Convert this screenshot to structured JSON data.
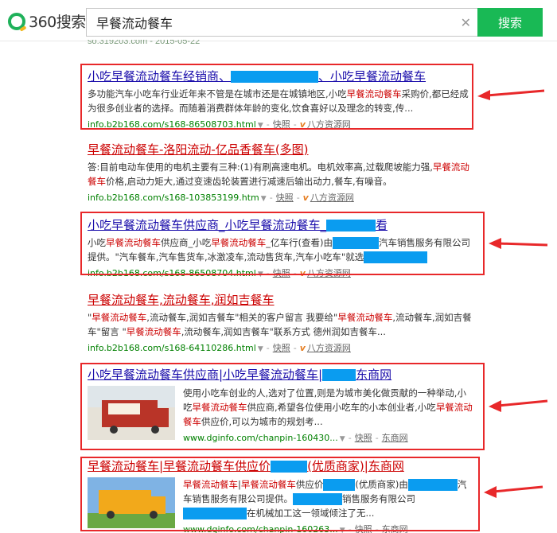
{
  "header": {
    "logo_text": "360搜索",
    "search_value": "早餐流动餐车",
    "search_button": "搜索"
  },
  "prev_result_url": "so.319203.com - 2015-05-22",
  "annotation_color": "#e8282a",
  "redaction_color": "#0a9cf0",
  "results": [
    {
      "title_a": "小吃早餐流动餐车经销商、",
      "title_b": "、小吃早餐流动餐车",
      "desc_1": "多功能汽车小吃车行业近年来不管是在城市还是在城镇地区,小吃",
      "desc_hl_1": "早餐流动餐车",
      "desc_2": "采购价,都已经成为很多创业者的选择。而随着消费群体年龄的变化,饮食喜好以及理念的转变,传...",
      "url": "info.b2b168.com/s168-86508703.html",
      "snapshot": "快照",
      "source": "八方资源网"
    },
    {
      "title": "早餐流动餐车-洛阳流动-亿品香餐车(多图)",
      "desc_1": "答:目前电动车使用的电机主要有三种:(1)有刷高速电机。电机效率高,过载爬坡能力强,",
      "desc_hl_1": "早餐流动餐车",
      "desc_2": "价格,启动力矩大,通过变速齿轮装置进行减速后输出动力,餐车,有噪音。",
      "url": "info.b2b168.com/s168-103853199.htm",
      "snapshot": "快照",
      "source": "八方资源网"
    },
    {
      "title_a": "小吃早餐流动餐车供应商_小吃早餐流动餐车_",
      "title_b": "看",
      "desc_1": "小吃",
      "desc_hl_1": "早餐流动餐车",
      "desc_2": "供应商_小吃",
      "desc_hl_2": "早餐流动餐车",
      "desc_3": "_亿车行(查看)由",
      "desc_4": "汽车销售服务有限公司提供。\"汽车餐车,汽车售货车,冰激凌车,流动售货车,汽车小吃车\"就选",
      "url": "info.b2b168.com/s168-86508704.html",
      "snapshot": "快照",
      "source": "八方资源网"
    },
    {
      "title": "早餐流动餐车,流动餐车,润如吉餐车",
      "desc_1": "\"",
      "desc_hl_1": "早餐流动餐车",
      "desc_2": ",流动餐车,润如吉餐车\"相关的客户留言 我要给\"",
      "desc_hl_2": "早餐流动餐车",
      "desc_3": ",流动餐车,润如吉餐车\"留言 \"",
      "desc_hl_3": "早餐流动餐车",
      "desc_4": ",流动餐车,润如吉餐车\"联系方式 德州润如吉餐车...",
      "url": "info.b2b168.com/s168-64110286.html",
      "snapshot": "快照",
      "source": "八方资源网"
    },
    {
      "title_a": "小吃早餐流动餐车供应商|小吃早餐流动餐车|",
      "title_b": "东商网",
      "desc_1": "使用小吃车创业的人,选对了位置,则是为城市美化做贡献的一种举动,小吃",
      "desc_hl_1": "早餐流动餐车",
      "desc_2": "供应商,希望各位使用小吃车的小本创业者,小吃",
      "desc_hl_2": "早餐流动餐车",
      "desc_3": "供应价,可以为城市的规划考...",
      "url": "www.dginfo.com/chanpin-160430...",
      "snapshot": "快照",
      "source": "东商网"
    },
    {
      "title_a": "早餐流动餐车|早餐流动餐车供应价",
      "title_b": "(优质商家)|东商网",
      "desc_hl_1": "早餐流动餐车",
      "desc_1": "|",
      "desc_hl_2": "早餐流动餐车",
      "desc_2": "供应价",
      "desc_3": "(优质商家)由",
      "desc_4": "汽车销售服务有限公司提供。",
      "desc_5": "销售服务有限公司",
      "desc_6": "在机械加工这一领域倾注了无...",
      "url": "www.dginfo.com/chanpin-160263...",
      "snapshot": "快照",
      "source": "东商网"
    }
  ]
}
